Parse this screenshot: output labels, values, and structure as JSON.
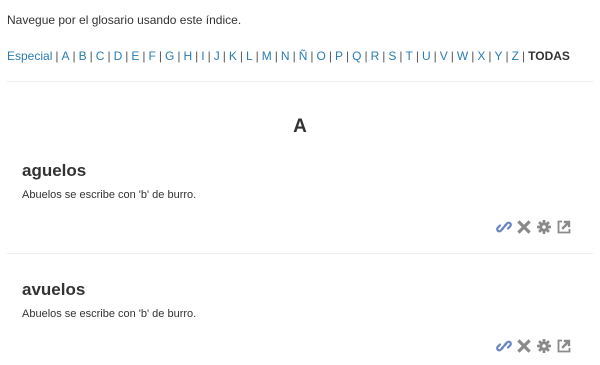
{
  "intro_text": "Navegue por el glosario usando este índice.",
  "alphabet": {
    "items": [
      {
        "label": "Especial"
      },
      {
        "label": "A"
      },
      {
        "label": "B"
      },
      {
        "label": "C"
      },
      {
        "label": "D"
      },
      {
        "label": "E"
      },
      {
        "label": "F"
      },
      {
        "label": "G"
      },
      {
        "label": "H"
      },
      {
        "label": "I"
      },
      {
        "label": "J"
      },
      {
        "label": "K"
      },
      {
        "label": "L"
      },
      {
        "label": "M"
      },
      {
        "label": "N"
      },
      {
        "label": "Ñ"
      },
      {
        "label": "O"
      },
      {
        "label": "P"
      },
      {
        "label": "Q"
      },
      {
        "label": "R"
      },
      {
        "label": "S"
      },
      {
        "label": "T"
      },
      {
        "label": "U"
      },
      {
        "label": "V"
      },
      {
        "label": "W"
      },
      {
        "label": "X"
      },
      {
        "label": "Y"
      },
      {
        "label": "Z"
      }
    ],
    "separator": "|",
    "current_label": "TODAS"
  },
  "section_letter": "A",
  "entries": [
    {
      "term": "aguelos",
      "definition": "Abuelos se escribe con 'b' de burro.",
      "actions": [
        "link-icon",
        "delete-icon",
        "settings-gear-icon",
        "export-icon"
      ]
    },
    {
      "term": "avuelos",
      "definition": "Abuelos se escribe con 'b' de burro.",
      "actions": [
        "link-icon",
        "delete-icon",
        "settings-gear-icon",
        "export-icon"
      ]
    }
  ],
  "colors": {
    "link": "#2a7bb4",
    "icon_link": "#6a86c5",
    "icon_gray": "#8a8a8a",
    "divider": "#eeeeee",
    "text": "#333333"
  }
}
